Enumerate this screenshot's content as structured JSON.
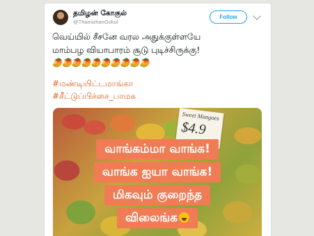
{
  "tweet": {
    "author_name": "தமிழன் கோகுல்",
    "handle": "@ThamizhanGokul",
    "follow_label": "Follow",
    "text_lines": [
      "வெய்யில் சீசனே வரல அதுக்குள்ளயே",
      "மாம்பழ வியாபாரம் சூடு புடிச்சிருக்கு!"
    ],
    "mango_emojis": "🥭🥭🥭🥭🥭🥭🥭🥭🥭🥭",
    "hashtags": [
      "#மண்டியிட்டமாங்கா",
      "#சீட்டுப்பிச்சை_பாமக"
    ]
  },
  "photo": {
    "price_tag": {
      "title": "Sweet Mangoes",
      "price": "$4.9"
    },
    "overlay_lines": [
      "வாங்கம்மா வாங்க!",
      "வாங்க ஐயா வாங்க!",
      "மிகவும் குறைந்த",
      "விலைங்க"
    ],
    "overlay_emoji": "laughing-crying-emoji"
  },
  "colors": {
    "follow_accent": "#1da1f2",
    "hashtag": "#e0662a",
    "overlay_bg": "#f07b54"
  }
}
